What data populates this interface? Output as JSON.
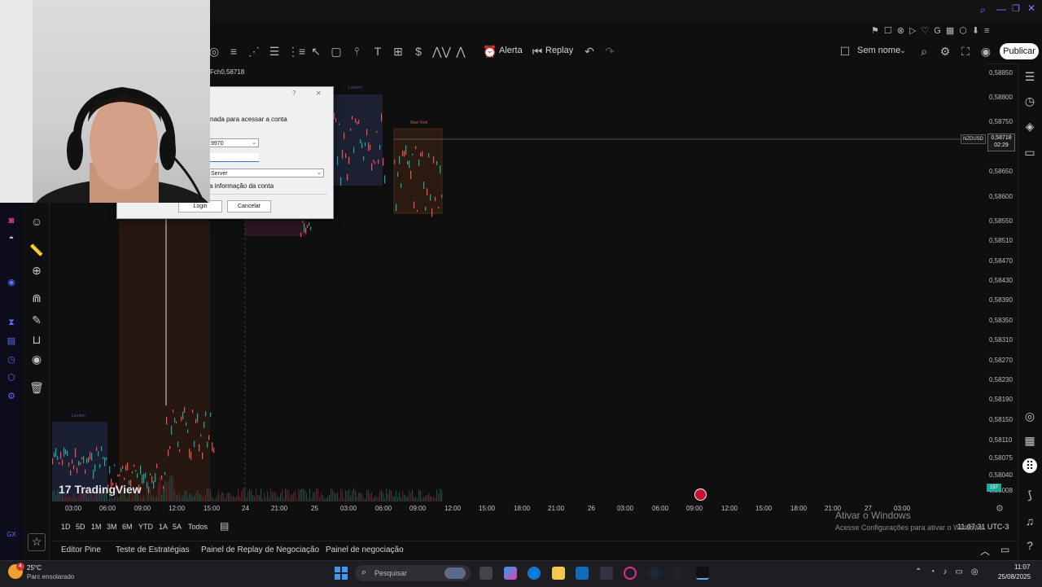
{
  "toolbar": {
    "alert_label": "Alerta",
    "replay_label": "Replay",
    "layout_name": "Sem nome",
    "publish_label": "Publicar"
  },
  "symbol": {
    "close_text": "Fch0,58718",
    "tag_name": "NZDUSD",
    "tag_price": "0,58718",
    "tag_countdown": "02:29"
  },
  "sessions": {
    "london_top": "London",
    "newyork_top": "New York",
    "london_bottom": "London"
  },
  "watermark": "TradingView",
  "price_axis": [
    "0,58850",
    "0,58800",
    "0,58750",
    "0,58650",
    "0,58600",
    "0,58550",
    "0,58510",
    "0,58470",
    "0,58430",
    "0,58390",
    "0,58350",
    "0,58310",
    "0,58270",
    "0,58230",
    "0,58190",
    "0,58150",
    "0,58110",
    "0,58075",
    "0,58040",
    "0,58008"
  ],
  "time_axis": [
    "03:00",
    "06:00",
    "09:00",
    "12:00",
    "15:00",
    "24",
    "21:00",
    "25",
    "03:00",
    "06:00",
    "09:00",
    "12:00",
    "15:00",
    "18:00",
    "21:00",
    "26",
    "03:00",
    "06:00",
    "09:00",
    "12:00",
    "15:00",
    "18:00",
    "21:00",
    "27",
    "03:00"
  ],
  "volume_badge": "157",
  "ranges": [
    "1D",
    "5D",
    "1M",
    "3M",
    "6M",
    "YTD",
    "1A",
    "5A",
    "Todos"
  ],
  "clock": "11:07:31 UTC-3",
  "windows_activation": {
    "title": "Ativar o Windows",
    "subtitle": "Acesse Configurações para ativar o Windows."
  },
  "bottom_tabs": [
    "Editor Pine",
    "Teste de Estratégias",
    "Painel de Replay de Negociação",
    "Painel de negociação"
  ],
  "dialog": {
    "help": "?",
    "close": "✕",
    "message": "nada para acessar a conta",
    "login_value": "9970",
    "server_value": "Server",
    "save_label": "a informação da conta",
    "login_btn": "Login",
    "cancel_btn": "Cancelar"
  },
  "taskbar": {
    "weather_temp": "25°C",
    "weather_desc": "Parc ensolarado",
    "weather_badge": "4",
    "search_placeholder": "Pesquisar",
    "time": "11:07",
    "date": "25/08/2025"
  },
  "colors": {
    "accent_blue": "#2962ff",
    "bull": "#26a69a",
    "bear": "#ef5350",
    "session_london": "#1b2033",
    "session_newyork": "#2a1a10"
  }
}
